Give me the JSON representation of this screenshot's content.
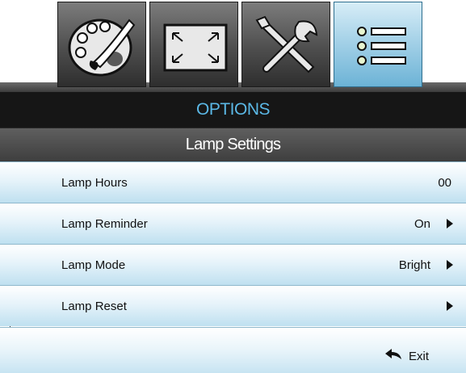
{
  "tabs": [
    {
      "icon": "palette-icon",
      "active": false
    },
    {
      "icon": "screen-resize-icon",
      "active": false
    },
    {
      "icon": "tools-icon",
      "active": false
    },
    {
      "icon": "options-list-icon",
      "active": true
    }
  ],
  "header": {
    "menu_title": "OPTIONS",
    "section_title": "Lamp Settings"
  },
  "rows": [
    {
      "label": "Lamp Hours",
      "value": "00",
      "has_arrow": false
    },
    {
      "label": "Lamp Reminder",
      "value": "On",
      "has_arrow": true
    },
    {
      "label": "Lamp Mode",
      "value": "Bright",
      "has_arrow": true
    },
    {
      "label": "Lamp Reset",
      "value": "",
      "has_arrow": true
    }
  ],
  "footer": {
    "exit_label": "Exit",
    "exit_icon": "return-arrow-icon"
  },
  "colors": {
    "title_text": "#5bb8e6",
    "active_tab": "#a6d2e8",
    "row_gradient_end": "#bfe0f0"
  }
}
